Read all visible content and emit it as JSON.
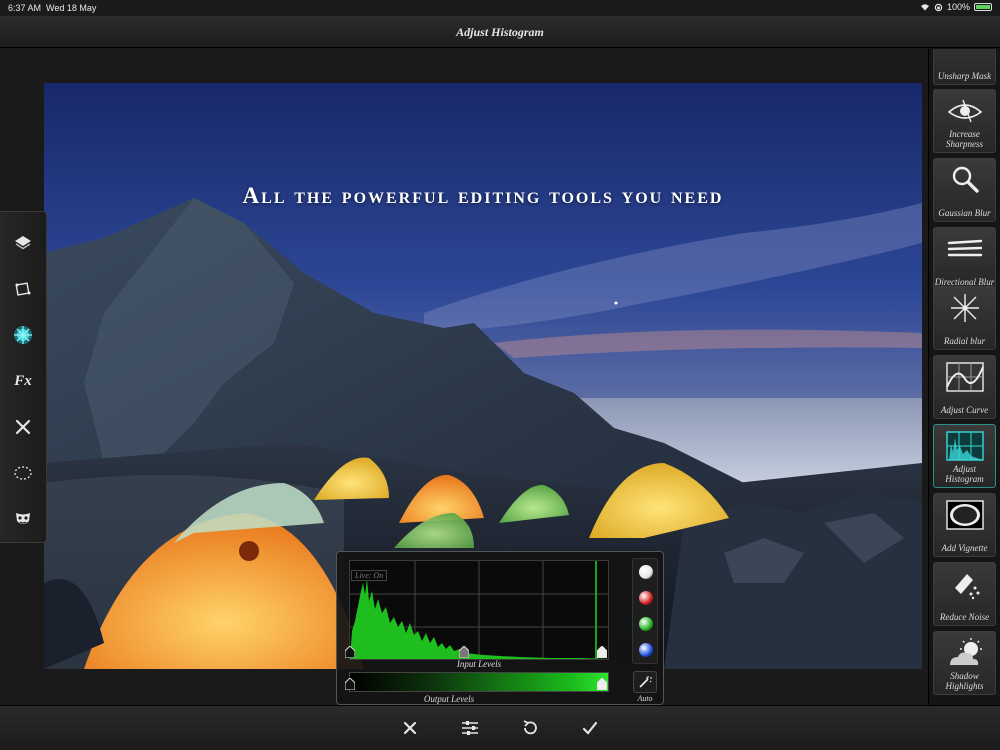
{
  "status_bar": {
    "time": "6:37 AM",
    "date": "Wed 18 May",
    "battery": "100%",
    "battery_level": 1.0
  },
  "title": "Adjust Histogram",
  "photo": {
    "headline": "All the powerful editing tools you need"
  },
  "left_tools": [
    {
      "name": "layers-icon"
    },
    {
      "name": "transform-icon"
    },
    {
      "name": "adjust-icon"
    },
    {
      "name": "fx-icon",
      "text": "Fx"
    },
    {
      "name": "tools-icon"
    },
    {
      "name": "selection-icon"
    },
    {
      "name": "mask-icon"
    }
  ],
  "right_tools": [
    {
      "label": "Unsharp Mask",
      "icon": "unsharp-mask-icon"
    },
    {
      "label": "Increase Sharpness",
      "icon": "eye-sharpness-icon"
    },
    {
      "label": "Gaussian Blur",
      "icon": "magnifier-icon"
    },
    {
      "label": "Directional Blur",
      "icon": "directional-blur-icon"
    },
    {
      "label": "Radial blur",
      "icon": "radial-blur-icon"
    },
    {
      "label": "Adjust Curve",
      "icon": "curve-icon"
    },
    {
      "label": "Adjust Histogram",
      "icon": "histogram-icon",
      "active": true
    },
    {
      "label": "Add Vignette",
      "icon": "vignette-icon"
    },
    {
      "label": "Reduce Noise",
      "icon": "reduce-noise-icon"
    },
    {
      "label": "Shadow Highlights",
      "icon": "shadow-highlights-icon"
    }
  ],
  "histogram": {
    "live_label": "Live: On",
    "input_label": "Input Levels",
    "output_label": "Output Levels",
    "auto_label": "Auto",
    "channels": [
      {
        "name": "luminance",
        "color": "#e8e8e8"
      },
      {
        "name": "red",
        "color": "#d22020"
      },
      {
        "name": "green",
        "color": "#22b222"
      },
      {
        "name": "blue",
        "color": "#2050e0"
      }
    ],
    "accent": "#1fd21f"
  },
  "bottom_bar": [
    {
      "name": "cancel-icon"
    },
    {
      "name": "sliders-icon"
    },
    {
      "name": "undo-icon"
    },
    {
      "name": "confirm-icon"
    }
  ]
}
